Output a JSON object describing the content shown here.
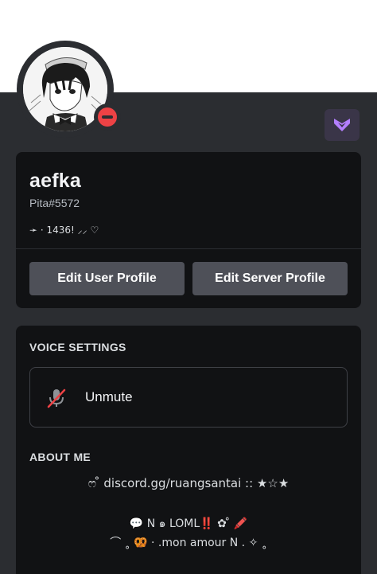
{
  "profile": {
    "display_name": "aefka",
    "tag": "Pita#5572",
    "custom_status": "➛ · 1436! ⸝⸝ ♡",
    "status": "do-not-disturb",
    "badge_icon": "nitro-icon"
  },
  "buttons": {
    "edit_user_profile": "Edit User Profile",
    "edit_server_profile": "Edit Server Profile"
  },
  "voice_settings": {
    "title": "VOICE SETTINGS",
    "unmute_label": "Unmute",
    "icon": "muted-microphone-icon"
  },
  "about_me": {
    "title": "ABOUT ME",
    "line1": "ෆ ̊ discord.gg/ruangsantai :: ★☆★",
    "line2": "💬 N ๑ LOML‼️ ✿ ̊ 🖍️",
    "line3": "⌒ ˳ 🥨 · .mon amour N . ✧ ˳"
  },
  "colors": {
    "panel": "#2b2d31",
    "card": "#111214",
    "button": "#4e5058",
    "dnd": "#ed4245",
    "nitro": "#b47fff"
  }
}
